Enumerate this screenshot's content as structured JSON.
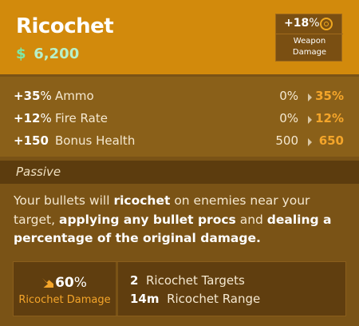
{
  "item": {
    "title": "Ricochet",
    "cost": "6,200",
    "cost_icon": "souls-currency-icon"
  },
  "weapon_damage": {
    "value": "+18",
    "unit": "%",
    "label": "Weapon Damage"
  },
  "stats": [
    {
      "bonus": "+35",
      "unit": "%",
      "name": "Ammo",
      "from": "0%",
      "to": "35%"
    },
    {
      "bonus": "+12",
      "unit": "%",
      "name": "Fire Rate",
      "from": "0%",
      "to": "12%"
    },
    {
      "bonus": "+150",
      "unit": "",
      "name": "Bonus Health",
      "from": "500",
      "to": "650"
    }
  ],
  "passive": {
    "label": "Passive",
    "description": {
      "p1": "Your bullets will ",
      "b1": "ricochet",
      "p2": " on enemies near your target, ",
      "b2": "applying any bullet procs",
      "p3": " and ",
      "b3": "dealing a percentage of the original damage."
    }
  },
  "ricochet": {
    "damage_value": "60",
    "damage_unit": "%",
    "damage_label": "Ricochet Damage",
    "targets_value": "2",
    "targets_label": "Ricochet Targets",
    "range_value": "14",
    "range_unit": "m",
    "range_label": "Ricochet Range"
  },
  "colors": {
    "header_bg": "#d28a0c",
    "card_bg": "#7a5316",
    "accent_orange": "#f4a52a",
    "currency_green": "#7ee8a8"
  }
}
